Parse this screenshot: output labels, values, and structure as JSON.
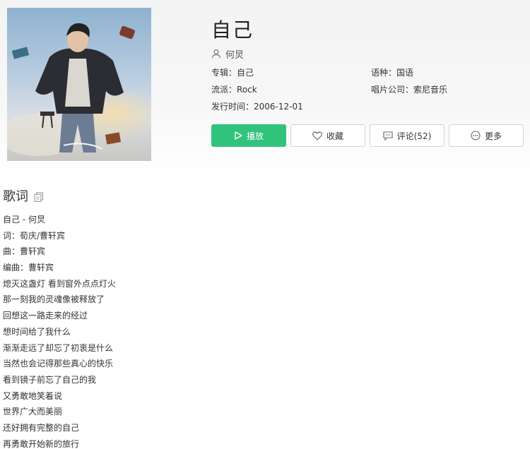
{
  "song": {
    "title": "自己",
    "artist": "何炅"
  },
  "meta": {
    "album_label": "专辑：",
    "album": "自己",
    "language_label": "语种：",
    "language": "国语",
    "genre_label": "流派：",
    "genre": "Rock",
    "label_label": "唱片公司：",
    "record_label": "索尼音乐",
    "release_label": "发行时间：",
    "release_date": "2006-12-01"
  },
  "actions": {
    "play": "播放",
    "favorite": "收藏",
    "comment": "评论(52)",
    "more": "更多"
  },
  "icons": {
    "artist": "user-icon",
    "play": "play-icon",
    "favorite": "heart-icon",
    "comment": "comment-icon",
    "more": "more-icon",
    "copy": "copy-icon"
  },
  "colors": {
    "accent": "#31c27c"
  },
  "lyrics": {
    "heading": "歌词",
    "lines": [
      "自己 - 何炅",
      "词：荀庆/曹轩宾",
      "曲：曹轩宾",
      "编曲：曹轩宾",
      "熄灭这盏灯 看到窗外点点灯火",
      "那一刻我的灵魂像被释放了",
      "回想这一路走来的经过",
      "想时间给了我什么",
      "渐渐走远了却忘了初衷是什么",
      "当然也会记得那些真心的快乐",
      "看到镜子前忘了自己的我",
      "又勇敢地笑着说",
      "世界广大而美丽",
      "还好拥有完整的自己",
      "再勇敢开始新的旅行"
    ]
  }
}
